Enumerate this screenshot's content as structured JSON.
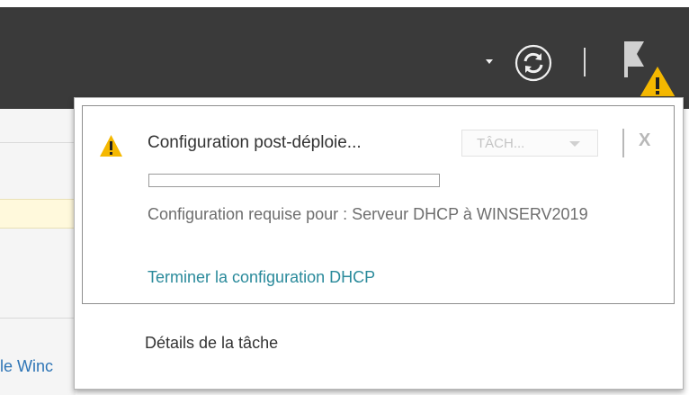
{
  "toolbar": {
    "dropdown_icon": "chevron-down-icon",
    "refresh_icon": "refresh-icon",
    "notifications_icon": "flag-warning-icon",
    "bar_color": "#3a3a3a"
  },
  "background": {
    "link_fragment": "le Winc"
  },
  "notification": {
    "title": "Configuration post-déploie...",
    "task_dropdown_label": "TÂCH...",
    "close_label": "X",
    "progress_fraction": 0,
    "status_text": "Configuration requise pour : Serveur DHCP à WINSERV2019",
    "action_link": "Terminer la configuration DHCP",
    "warning_color": "#f5b800",
    "link_color": "#2a8a9b"
  },
  "footer": {
    "task_details_label": "Détails de la tâche"
  }
}
